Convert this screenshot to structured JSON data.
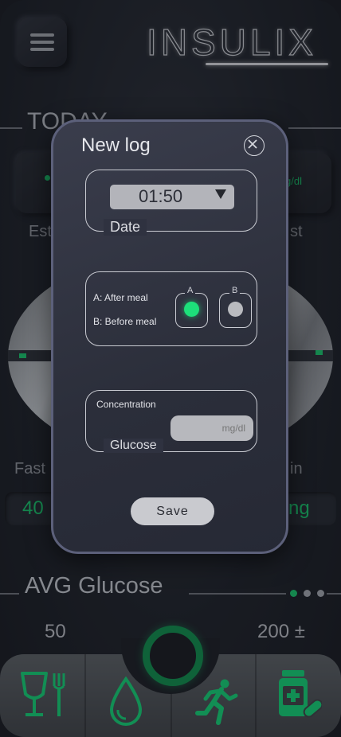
{
  "header": {
    "brand": "INSULIX"
  },
  "today": {
    "title": "TODAY",
    "left_card_text": "",
    "right_card_text": "g/dl",
    "left_label": "Est",
    "right_label": "st",
    "left_sub_label": "Fast",
    "right_sub_label": "in",
    "left_pill_value": "40",
    "right_pill_value": "ng"
  },
  "avg": {
    "title": "AVG Glucose",
    "left_value": "50",
    "right_value": "200 ±"
  },
  "modal": {
    "title": "New log",
    "date_group_label": "Date",
    "time_value": "01:50",
    "option_a_text": "A: After meal",
    "option_b_text": "B: Before meal",
    "radio_a_tag": "A",
    "radio_b_tag": "B",
    "selected_option": "A",
    "concentration_label": "Concentration",
    "glucose_group_label": "Glucose",
    "unit_placeholder": "mg/dl",
    "save_label": "Save"
  },
  "colors": {
    "accent_green": "#17c46a",
    "radio_active": "#1de07a",
    "radio_inactive": "#b9babf",
    "modal_border": "#5c607a"
  },
  "nav": {
    "items": [
      "fork-knife-icon",
      "drop-icon",
      "running-person-icon",
      "medicine-icon"
    ]
  }
}
